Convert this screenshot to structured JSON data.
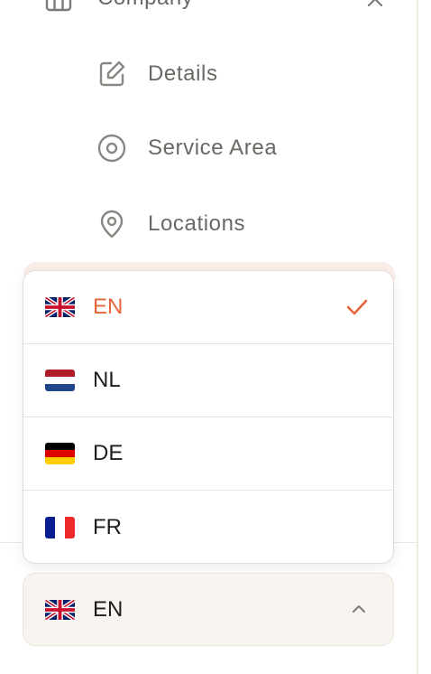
{
  "sidebar": {
    "section": {
      "label": "Company",
      "icon": "building-icon"
    },
    "items": [
      {
        "label": "Details",
        "icon": "edit-icon"
      },
      {
        "label": "Service Area",
        "icon": "target-icon"
      },
      {
        "label": "Locations",
        "icon": "map-pin-icon"
      }
    ]
  },
  "language_dropdown": {
    "options": [
      {
        "code": "EN",
        "flag": "uk-flag-icon",
        "selected": true
      },
      {
        "code": "NL",
        "flag": "netherlands-flag-icon",
        "selected": false
      },
      {
        "code": "DE",
        "flag": "germany-flag-icon",
        "selected": false
      },
      {
        "code": "FR",
        "flag": "france-flag-icon",
        "selected": false
      }
    ],
    "current": {
      "code": "EN",
      "flag": "uk-flag-icon"
    }
  },
  "colors": {
    "accent": "#e8643a",
    "text_muted": "#6b6864",
    "text_dark": "#1f1d1b",
    "button_bg": "#f7f3ee"
  }
}
